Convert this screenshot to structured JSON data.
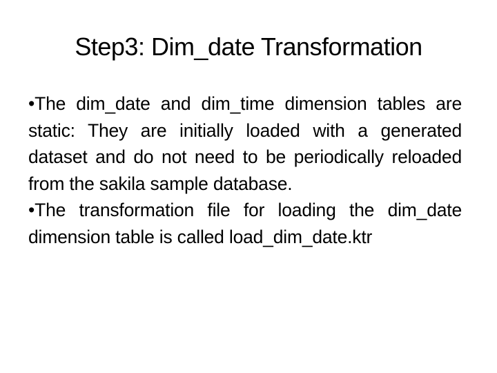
{
  "slide": {
    "title": "Step3: Dim_date Transformation",
    "bullets": [
      {
        "marker": "•",
        "text": "The dim_date and dim_time dimension tables are static: They are initially loaded with a generated dataset and do not need to be periodically reloaded from the sakila sample database."
      },
      {
        "marker": "•",
        "text": "The transformation file for loading the dim_date dimension table is called load_dim_date.ktr"
      }
    ]
  }
}
